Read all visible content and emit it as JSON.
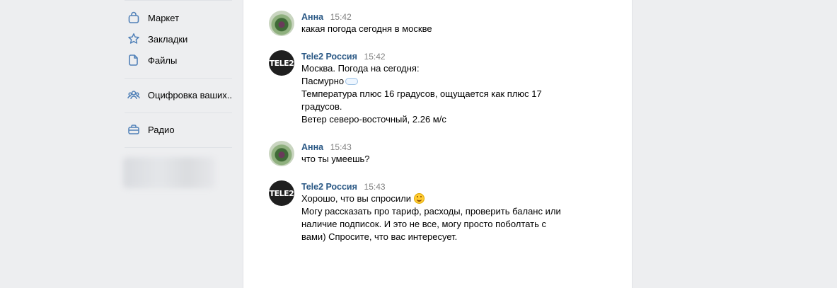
{
  "sidebar": {
    "items": [
      {
        "label": "Маркет",
        "icon": "bag-icon"
      },
      {
        "label": "Закладки",
        "icon": "star-icon"
      },
      {
        "label": "Файлы",
        "icon": "file-icon"
      },
      {
        "label": "Оцифровка ваших..",
        "icon": "people-icon"
      },
      {
        "label": "Радио",
        "icon": "radio-icon"
      }
    ]
  },
  "messages": [
    {
      "author": "Анна",
      "time": "15:42",
      "avatar": "anna",
      "lines": [
        "какая погода сегодня в москве"
      ]
    },
    {
      "author": "Tele2 Россия",
      "time": "15:42",
      "avatar": "tele2",
      "lines": [
        "Москва. Погода на сегодня:",
        "Пасмурно",
        "Температура плюс 16 градусов, ощущается как плюс 17",
        "градусов.",
        "Ветер северо-восточный, 2.26 м/с"
      ]
    },
    {
      "author": "Анна",
      "time": "15:43",
      "avatar": "anna",
      "lines": [
        "что ты умеешь?"
      ]
    },
    {
      "author": "Tele2 Россия",
      "time": "15:43",
      "avatar": "tele2",
      "lines": [
        "Хорошо, что вы спросили",
        "Могу рассказать про тариф, расходы, проверить баланс или",
        "наличие подписок. И это не все, могу просто поболтать с",
        "вами) Спросите, что вас интересует."
      ]
    }
  ],
  "tele2_logo_text": "TELE2",
  "colors": {
    "background": "#edeef0",
    "author": "#2a5885",
    "time": "#828282",
    "icon": "#5181b8"
  }
}
